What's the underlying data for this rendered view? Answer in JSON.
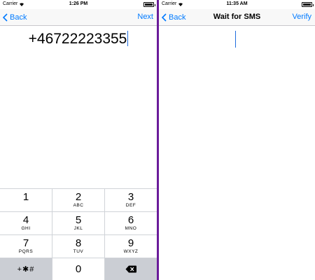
{
  "left_screen": {
    "status": {
      "carrier": "Carrier",
      "time": "1:26 PM"
    },
    "nav": {
      "back_label": "Back",
      "action_label": "Next"
    },
    "phone_number": "+46722223355",
    "keypad": {
      "keys": [
        {
          "digit": "1",
          "letters": ""
        },
        {
          "digit": "2",
          "letters": "ABC"
        },
        {
          "digit": "3",
          "letters": "DEF"
        },
        {
          "digit": "4",
          "letters": "GHI"
        },
        {
          "digit": "5",
          "letters": "JKL"
        },
        {
          "digit": "6",
          "letters": "MNO"
        },
        {
          "digit": "7",
          "letters": "PQRS"
        },
        {
          "digit": "8",
          "letters": "TUV"
        },
        {
          "digit": "9",
          "letters": "WXYZ"
        }
      ],
      "symbols_label": "+✱#",
      "zero": "0",
      "delete_icon": "backspace-icon"
    }
  },
  "right_screen": {
    "status": {
      "carrier": "Carrier",
      "time": "11:35 AM"
    },
    "nav": {
      "back_label": "Back",
      "title": "Wait for SMS",
      "action_label": "Verify"
    }
  },
  "colors": {
    "accent": "#007aff",
    "divider": "#6a1b9a",
    "caret": "#1f6dde"
  }
}
